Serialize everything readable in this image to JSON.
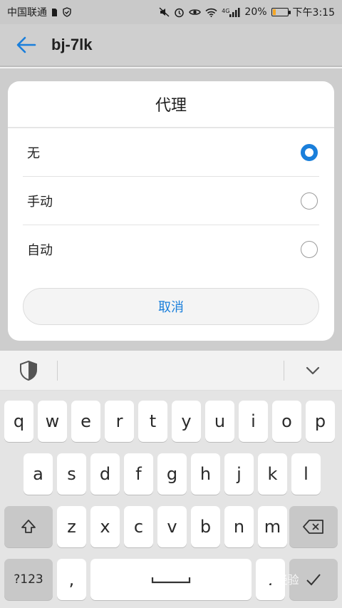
{
  "status_bar": {
    "carrier": "中国联通",
    "signal_badge": "4G",
    "battery_percent": "20%",
    "battery_level": 0.2,
    "time": "下午3:15",
    "icons": [
      "sim-card-icon",
      "shield-check-icon",
      "mute-icon",
      "alarm-icon",
      "eye-icon",
      "wifi-icon",
      "cell-signal-icon",
      "battery-icon"
    ]
  },
  "app_bar": {
    "title": "bj-7lk"
  },
  "dialog": {
    "title": "代理",
    "options": [
      {
        "label": "无",
        "selected": true
      },
      {
        "label": "手动",
        "selected": false
      },
      {
        "label": "自动",
        "selected": false
      }
    ],
    "cancel_label": "取消"
  },
  "keyboard": {
    "row1": [
      "q",
      "w",
      "e",
      "r",
      "t",
      "y",
      "u",
      "i",
      "o",
      "p"
    ],
    "row2": [
      "a",
      "s",
      "d",
      "f",
      "g",
      "h",
      "j",
      "k",
      "l"
    ],
    "row3": [
      "z",
      "x",
      "c",
      "v",
      "b",
      "n",
      "m"
    ],
    "symbols_label": "?123",
    "comma_label": ","
  },
  "watermark": "Bai 经验",
  "colors": {
    "accent": "#1a7fdb",
    "battery": "#f5a623"
  }
}
